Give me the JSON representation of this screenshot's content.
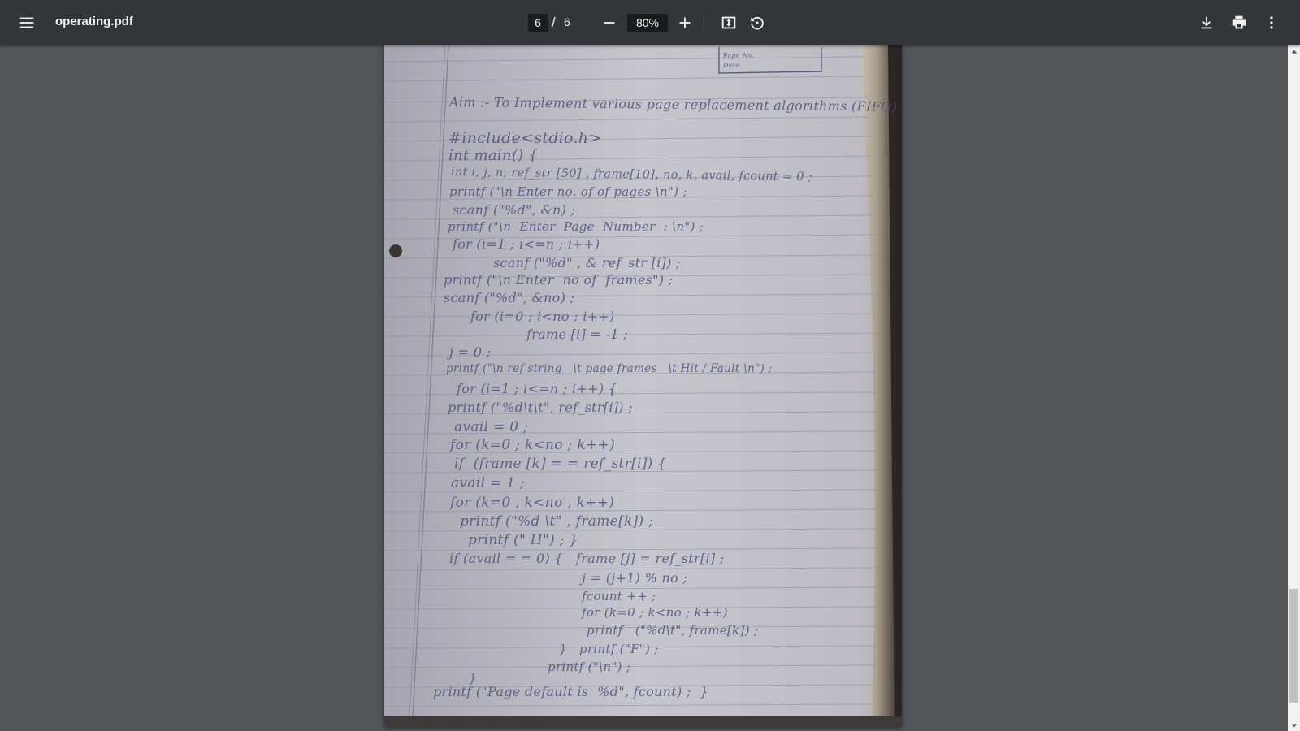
{
  "toolbar": {
    "title": "operating.pdf",
    "current_page": "6",
    "page_separator": "/",
    "total_pages": "6",
    "zoom": "80%"
  },
  "icons": {
    "menu": "menu-icon",
    "zoom_out": "minus-icon",
    "zoom_in": "plus-icon",
    "fit": "fit-to-page-icon",
    "rotate": "rotate-icon",
    "download": "download-icon",
    "print": "print-icon",
    "more": "more-vert-icon"
  },
  "colors": {
    "toolbar_bg": "#323639",
    "viewer_bg": "#525659",
    "ink": "#4a4d7a",
    "paper": "#b9b8c0"
  },
  "scroll": {
    "position_fraction": 0.97
  },
  "page_content": {
    "header_box": [
      "Page No.",
      "Date:"
    ],
    "lines": [
      "Aim :- To Implement various page replacement algorithms (FIFO)",
      "#include<stdio.h>",
      "int main() {",
      "int i, j, n, ref_str [50] , frame[10], no, k, avail, fcount = 0 ;",
      "printf (\"\\n Enter no. of of pages \\n\") ;",
      "scanf (\"%d\", &n) ;",
      "printf (\"\\n  Enter  Page  Number  : \\n\") ;",
      "for (i=1 ; i<=n ; i++)",
      "scanf (\"%d\" , & ref_str [i]) ;",
      "printf (\"\\n Enter  no of  frames\") ;",
      "scanf (\"%d\", &no) ;",
      "for (i=0 ; i<no ; i++)",
      "frame [i] = -1 ;",
      "j = 0 ;",
      "printf (\"\\n ref string   \\t page frames   \\t Hit / Fault \\n\") ;",
      "for (i=1 ; i<=n ; i++) {",
      "printf (\"%d\\t\\t\", ref_str[i]) ;",
      "avail = 0 ;",
      "for (k=0 ; k<no ; k++)",
      "if  (frame [k] = = ref_str[i]) {",
      "avail = 1 ;",
      "for (k=0 , k<no , k++)",
      "printf (\"%d \\t\" , frame[k]) ;",
      "printf (\" H\") ; }",
      "if (avail = = 0) {   frame [j] = ref_str[i] ;",
      "j = (j+1) % no ;",
      "fcount ++ ;",
      "for (k=0 ; k<no ; k++)",
      "printf   (\"%d\\t\", frame[k]) ;",
      "}   printf (\"F\") ;",
      "printf (\"\\n\") ;",
      "}",
      "printf (\"Page default is  %d\", fcount) ;  }"
    ]
  }
}
